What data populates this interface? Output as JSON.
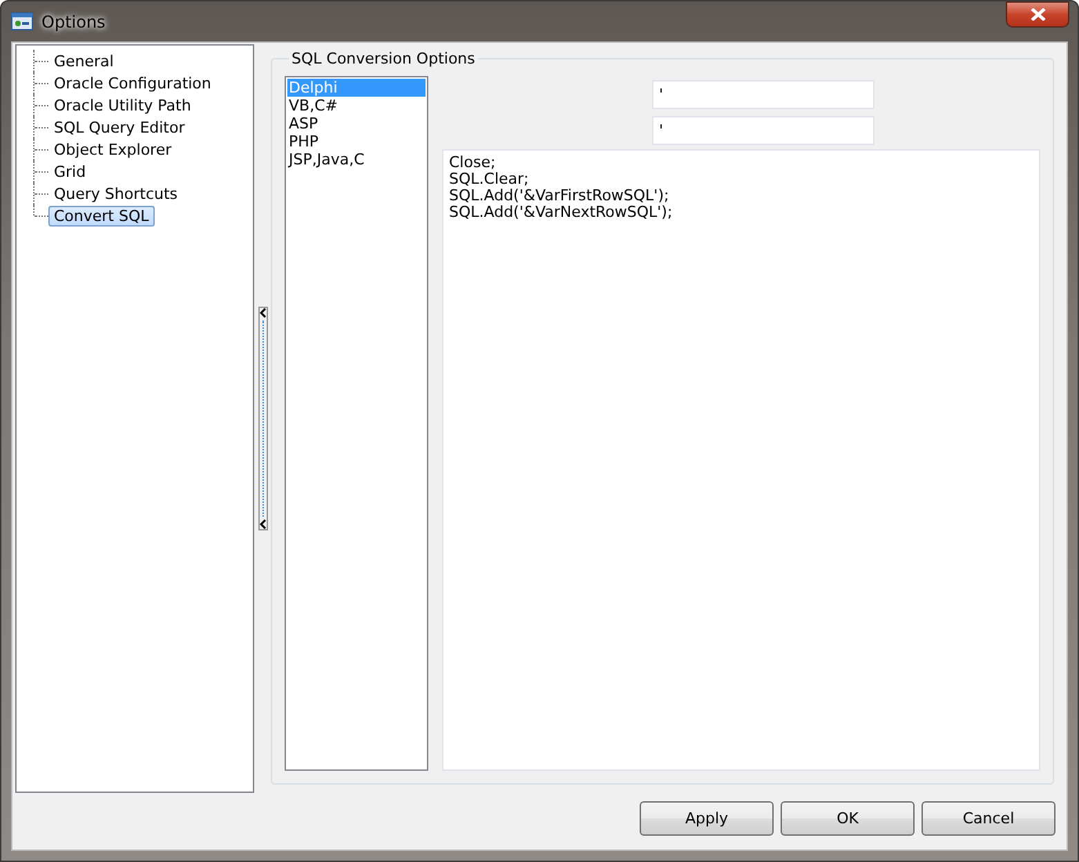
{
  "window": {
    "title": "Options"
  },
  "sidebar": {
    "items": [
      {
        "label": "General",
        "selected": false
      },
      {
        "label": "Oracle Configuration",
        "selected": false
      },
      {
        "label": "Oracle Utility Path",
        "selected": false
      },
      {
        "label": "SQL Query Editor",
        "selected": false
      },
      {
        "label": "Object Explorer",
        "selected": false
      },
      {
        "label": "Grid",
        "selected": false
      },
      {
        "label": "Query Shortcuts",
        "selected": false
      },
      {
        "label": "Convert SQL",
        "selected": true
      }
    ]
  },
  "group": {
    "title": "SQL Conversion Options",
    "languages": [
      {
        "label": "Delphi",
        "selected": true
      },
      {
        "label": "VB,C#",
        "selected": false
      },
      {
        "label": "ASP",
        "selected": false
      },
      {
        "label": "PHP",
        "selected": false
      },
      {
        "label": "JSP,Java,C",
        "selected": false
      }
    ],
    "fields": [
      {
        "value": "'"
      },
      {
        "value": "'"
      }
    ],
    "template": [
      "Close;",
      "SQL.Clear;",
      "SQL.Add('&VarFirstRowSQL');",
      "SQL.Add('&VarNextRowSQL');"
    ]
  },
  "buttons": [
    "Apply",
    "OK",
    "Cancel"
  ]
}
